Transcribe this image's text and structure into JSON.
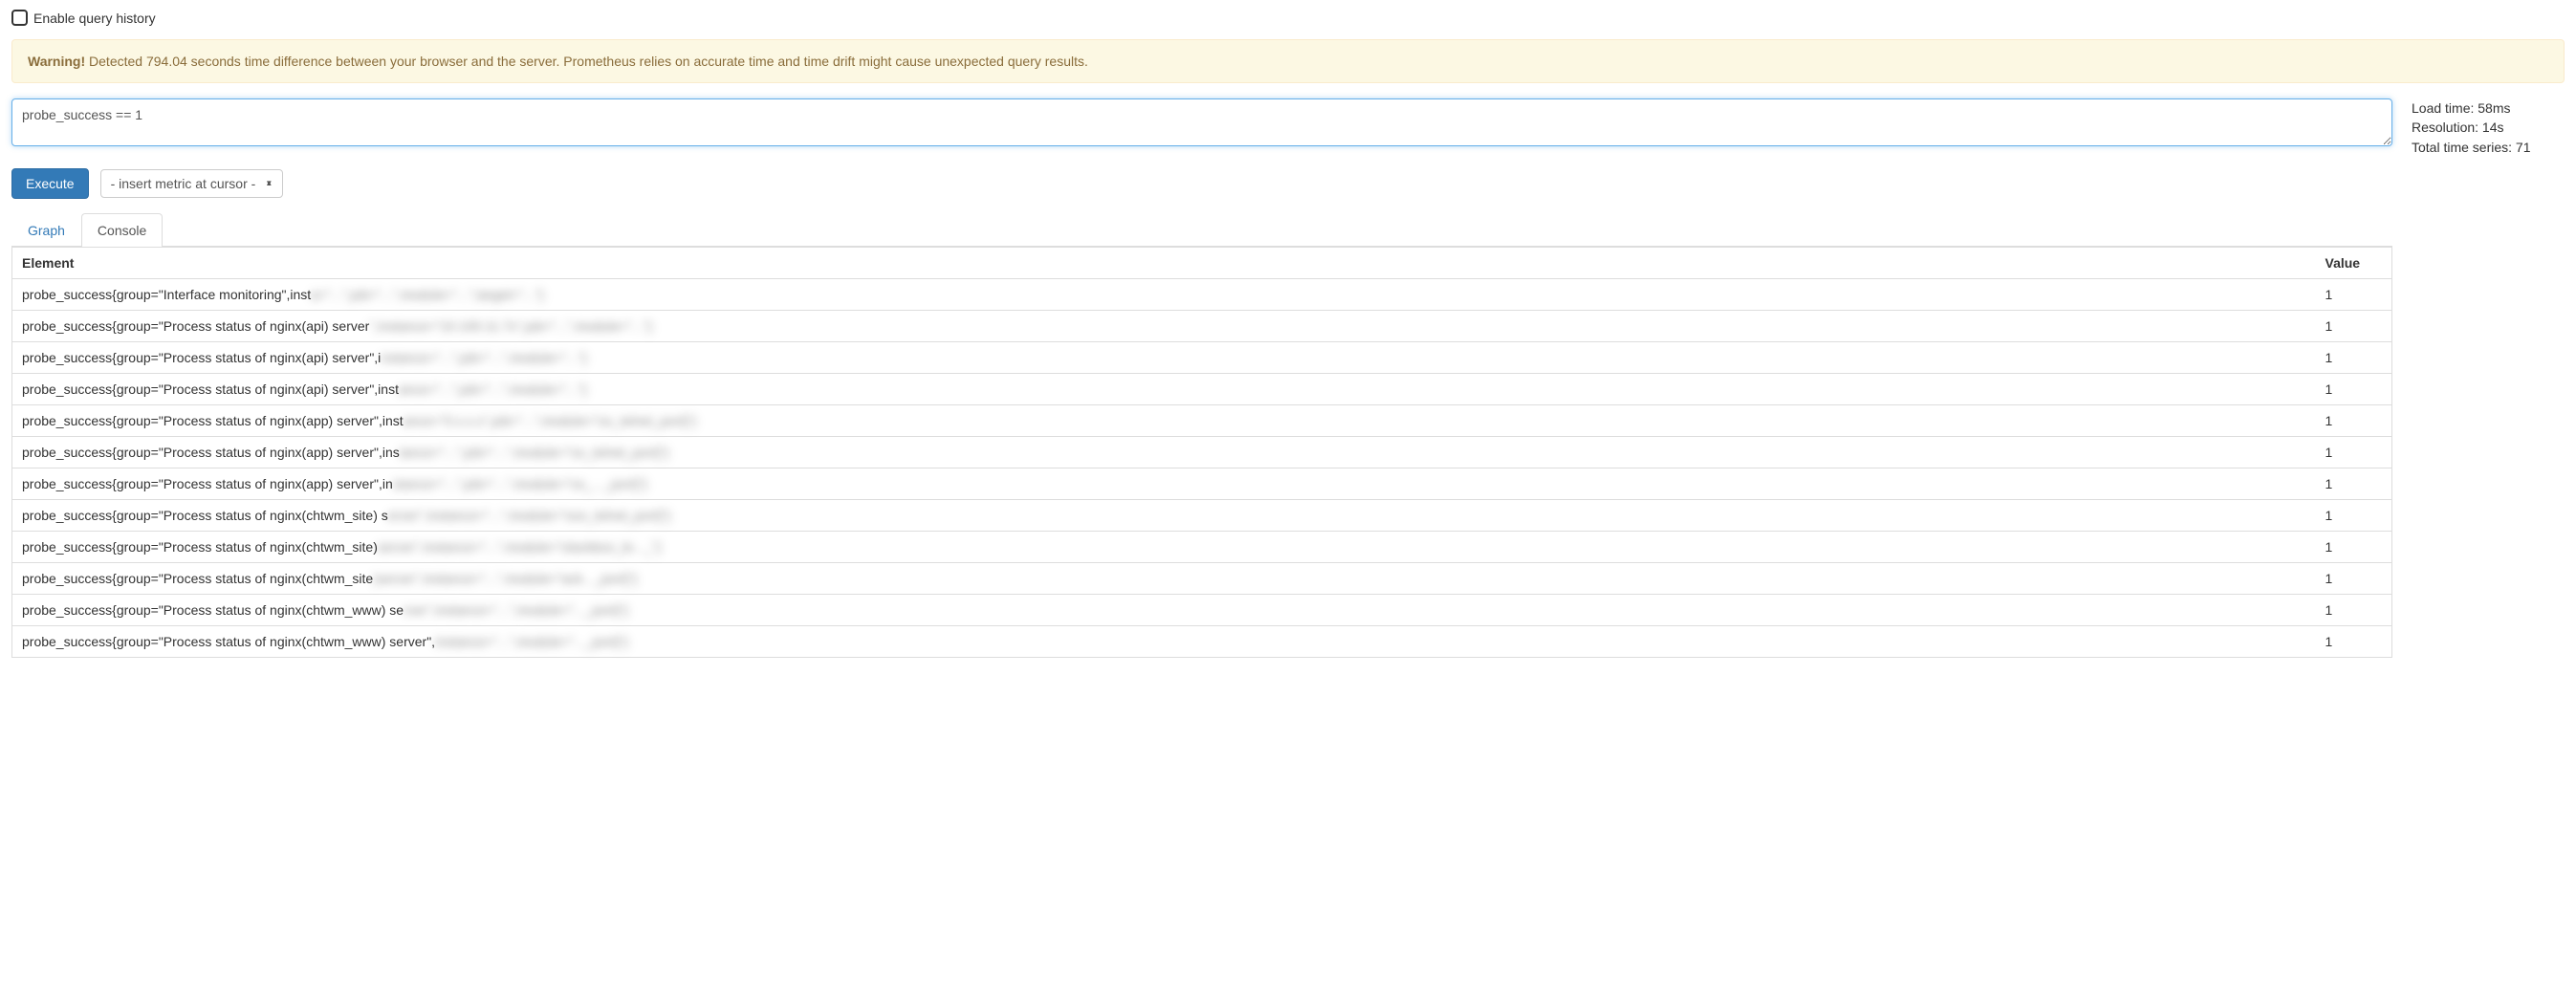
{
  "history": {
    "label": "Enable query history"
  },
  "warning": {
    "strong": "Warning!",
    "text": " Detected 794.04 seconds time difference between your browser and the server. Prometheus relies on accurate time and time drift might cause unexpected query results."
  },
  "query": {
    "value": "probe_success == 1"
  },
  "stats": {
    "load_time": "Load time: 58ms",
    "resolution": "Resolution: 14s",
    "total_series": "Total time series: 71"
  },
  "controls": {
    "execute": "Execute",
    "metric_placeholder": "- insert metric at cursor -"
  },
  "tabs": {
    "graph": "Graph",
    "console": "Console"
  },
  "table": {
    "headers": {
      "element": "Element",
      "value": "Value"
    },
    "rows": [
      {
        "prefix": "probe_success{group=\"Interface monitoring\",inst",
        "value": "1"
      },
      {
        "prefix": "probe_success{group=\"Process status of nginx(api) server",
        "value": "1"
      },
      {
        "prefix": "probe_success{group=\"Process status of nginx(api) server\",i",
        "value": "1"
      },
      {
        "prefix": "probe_success{group=\"Process status of nginx(api) server\",inst",
        "value": "1"
      },
      {
        "prefix": "probe_success{group=\"Process status of nginx(app) server\",inst",
        "value": "1"
      },
      {
        "prefix": "probe_success{group=\"Process status of nginx(app) server\",ins",
        "value": "1"
      },
      {
        "prefix": "probe_success{group=\"Process status of nginx(app) server\",in",
        "value": "1"
      },
      {
        "prefix": "probe_success{group=\"Process status of nginx(chtwm_site) s",
        "value": "1"
      },
      {
        "prefix": "probe_success{group=\"Process status of nginx(chtwm_site)",
        "value": "1"
      },
      {
        "prefix": "probe_success{group=\"Process status of nginx(chtwm_site",
        "value": "1"
      },
      {
        "prefix": "probe_success{group=\"Process status of nginx(chtwm_www) se",
        "value": "1"
      },
      {
        "prefix": "probe_success{group=\"Process status of nginx(chtwm_www) server\",",
        "value": "1"
      }
    ]
  },
  "redacted_tails": [
    "a=\"...\",job=\"...\",module=\"...\",target=\"...\"} ",
    "\",instance=\"10.100.11.7x\",job=\"...\",module=\"...\"} ",
    "nstance=\"...\",job=\"...\",module=\"...\"} ",
    "ance=\"...\",job=\"...\",module=\"...\"} ",
    "ance=\"0.x.x.x\",job=\"...\",module=\"ox_telnet_port]\"}",
    "tance=\"...\",job=\"...\",module=\"ox_telnet_port]\"}",
    "stance=\"...\",job=\"...\",module=\"ox_..._port]\"}",
    "erver\",instance=\"...\",module=\"oox_telnet_port]\"}",
    "server\",instance=\"...\",module=\"olackbox_te..._\"}",
    ")server\",instance=\"...\",module=\"ack..._port]\"}",
    "rver\",instance=\"...\",module=\"..._port]\"}",
    "instance=\"...\",module=\"..._port]\"}"
  ]
}
